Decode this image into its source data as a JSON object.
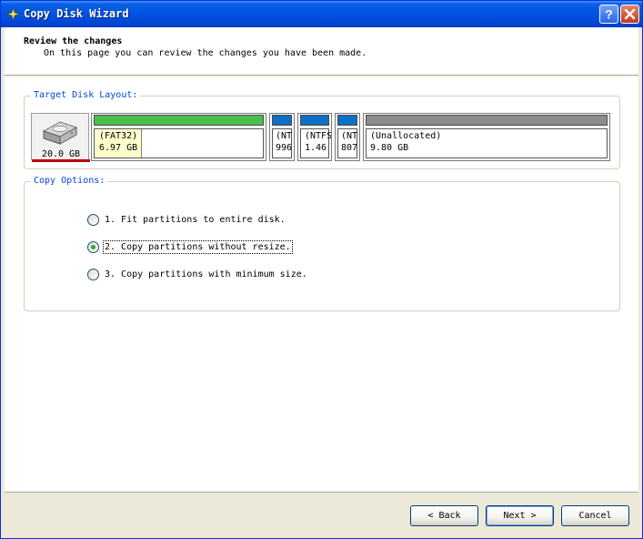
{
  "window": {
    "title": "Copy Disk Wizard"
  },
  "header": {
    "title": "Review the changes",
    "subtitle": "On this page you can review the changes you have been made."
  },
  "layout_group": {
    "label": "Target Disk Layout:",
    "disk": {
      "size": "20.0 GB",
      "icon": "hard-disk-icon"
    },
    "partitions": [
      {
        "line1": "(FAT32)",
        "line2": "6.97 GB",
        "bar_color": "#49c049",
        "used_fraction": 0.28
      },
      {
        "line1": "(NT",
        "line2": "996",
        "bar_color": "#0f6fc6"
      },
      {
        "line1": "(NTFS",
        "line2": "1.46",
        "bar_color": "#0f6fc6"
      },
      {
        "line1": "(NT",
        "line2": "807",
        "bar_color": "#0f6fc6"
      },
      {
        "line1": "(Unallocated)",
        "line2": "9.80 GB",
        "bar_color": "#8c8c8c"
      }
    ]
  },
  "options_group": {
    "label": "Copy Options:",
    "options": [
      {
        "label": "1. Fit partitions to entire disk.",
        "checked": false
      },
      {
        "label": "2. Copy partitions without resize.",
        "checked": true
      },
      {
        "label": "3. Copy partitions with minimum size.",
        "checked": false
      }
    ]
  },
  "buttons": {
    "back": "< Back",
    "next": "Next >",
    "cancel": "Cancel"
  },
  "colors": {
    "titlebar": "#0054e3",
    "group_label": "#0046d5",
    "selected_underline": "#c00000"
  }
}
